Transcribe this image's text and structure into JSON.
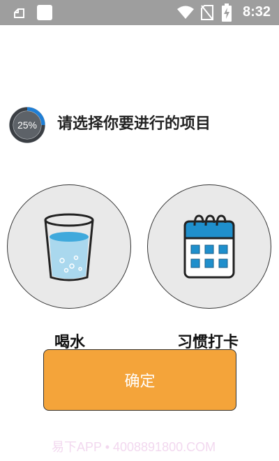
{
  "status_bar": {
    "time": "8:32",
    "icons": [
      "notification-icon",
      "app-icon",
      "wifi-icon",
      "no-sim-icon",
      "battery-charging-icon"
    ]
  },
  "progress": {
    "percent_label": "25%",
    "value": 0.25
  },
  "prompt": "请选择你要进行的项目",
  "options": [
    {
      "label": "喝水",
      "icon": "water-glass-icon"
    },
    {
      "label": "习惯打卡",
      "icon": "calendar-icon"
    }
  ],
  "confirm_label": "确定",
  "watermark": "易下APP • 4008891800.COM",
  "colors": {
    "accent": "#f4a43a",
    "status_bar": "#9e9e9e",
    "option_bg": "#e9e9e9",
    "calendar_blue": "#1f8fcc"
  }
}
